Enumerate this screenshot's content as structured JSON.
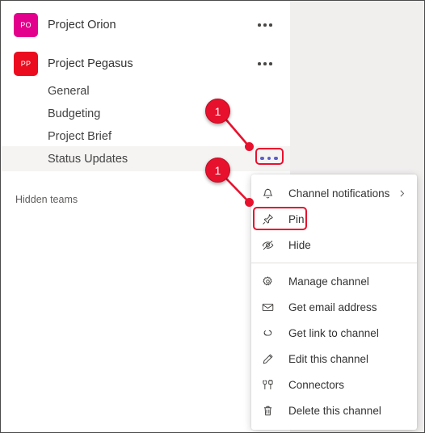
{
  "window": {
    "left_panel_bg": "#ffffff",
    "page_bg": "#f0efee",
    "accent_red": "#e8112d",
    "menu_dots_color": "#5b5fc7"
  },
  "teams_panel": {
    "teams": [
      {
        "initials": "PO",
        "name": "Project Orion",
        "avatar_color": "#e3008c",
        "more_icon": "more-horizontal-icon"
      },
      {
        "initials": "PP",
        "name": "Project Pegasus",
        "avatar_color": "#eb0c1f",
        "more_icon": "more-horizontal-icon"
      }
    ],
    "channels": [
      {
        "name": "General",
        "selected": false
      },
      {
        "name": "Budgeting",
        "selected": false
      },
      {
        "name": "Project Brief",
        "selected": false
      },
      {
        "name": "Status Updates",
        "selected": true
      }
    ],
    "hidden_teams_label": "Hidden teams"
  },
  "context_menu": {
    "items": [
      {
        "label": "Channel notifications",
        "icon": "bell-icon",
        "submenu": true,
        "highlighted": false
      },
      {
        "label": "Pin",
        "icon": "pin-icon",
        "submenu": false,
        "highlighted": true
      },
      {
        "label": "Hide",
        "icon": "eye-off-icon",
        "submenu": false,
        "highlighted": false
      },
      {
        "label": "Manage channel",
        "icon": "gear-icon",
        "submenu": false,
        "highlighted": false
      },
      {
        "label": "Get email address",
        "icon": "envelope-icon",
        "submenu": false,
        "highlighted": false
      },
      {
        "label": "Get link to channel",
        "icon": "link-icon",
        "submenu": false,
        "highlighted": false
      },
      {
        "label": "Edit this channel",
        "icon": "pencil-icon",
        "submenu": false,
        "highlighted": false
      },
      {
        "label": "Connectors",
        "icon": "connector-icon",
        "submenu": false,
        "highlighted": false
      },
      {
        "label": "Delete this channel",
        "icon": "trash-icon",
        "submenu": false,
        "highlighted": false
      }
    ],
    "separator_after_index": 2
  },
  "annotations": {
    "callouts": [
      {
        "number": "1",
        "target": "channel-more-button"
      },
      {
        "number": "1",
        "target": "pin-menu-item"
      }
    ]
  }
}
